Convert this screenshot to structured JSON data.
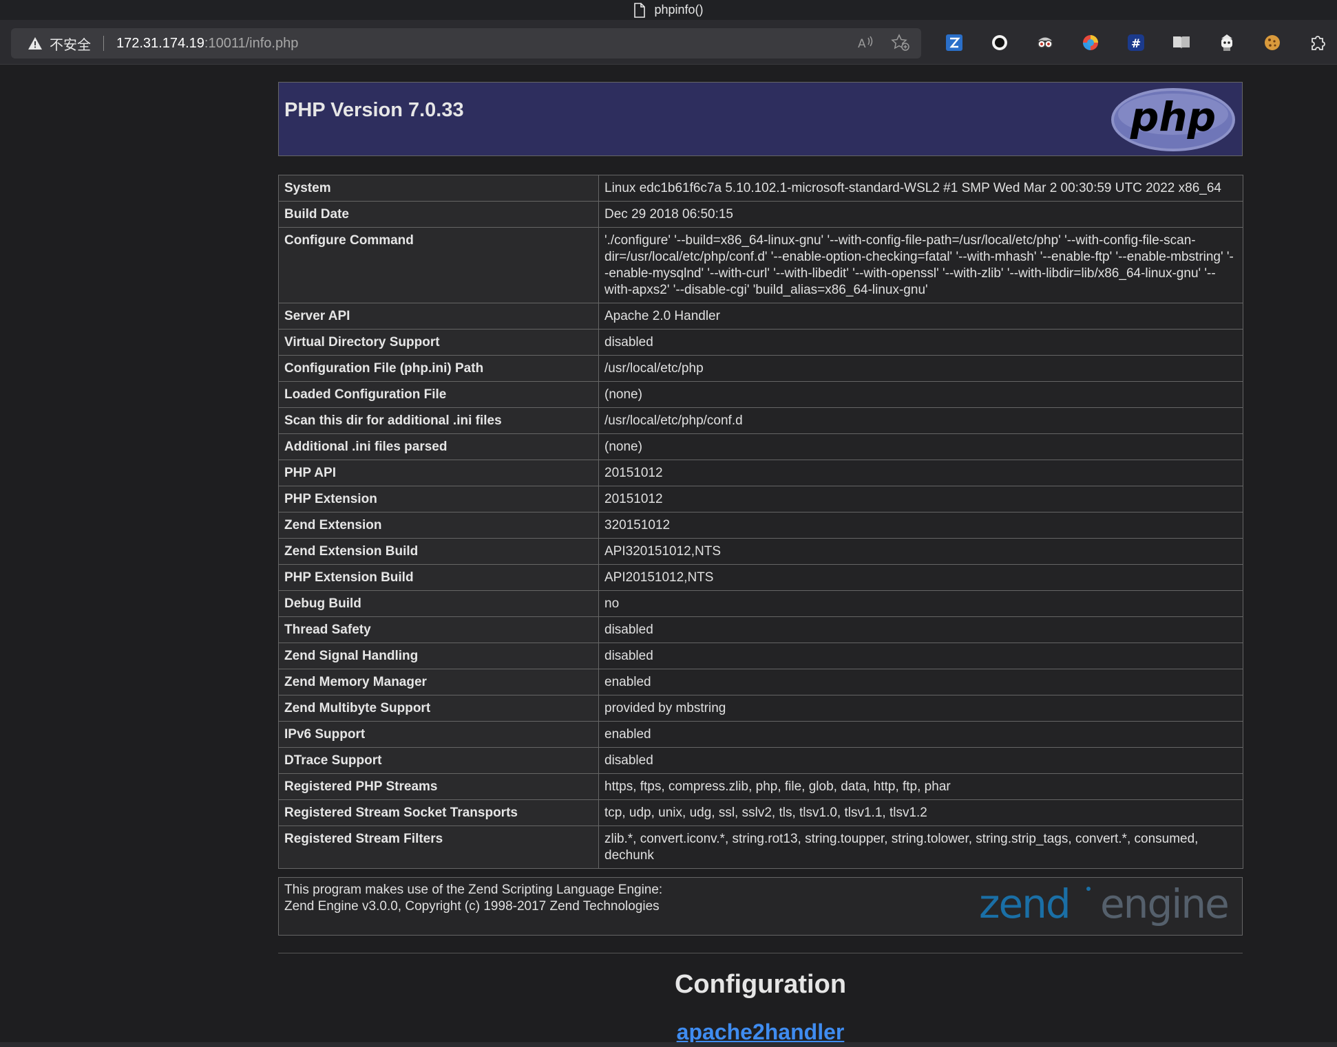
{
  "window": {
    "title": "phpinfo()"
  },
  "addressbar": {
    "security_label": "不安全",
    "url_host": "172.31.174.19",
    "url_rest": ":10011/info.php"
  },
  "extensions": [
    "zotero-icon",
    "circle-icon",
    "face-icon",
    "colorful-icon",
    "hash-icon",
    "reader-icon",
    "bot-icon",
    "cookie-icon",
    "puzzle-icon"
  ],
  "header": {
    "version_title": "PHP Version 7.0.33"
  },
  "info_rows": [
    {
      "key": "System",
      "value": "Linux edc1b61f6c7a 5.10.102.1-microsoft-standard-WSL2 #1 SMP Wed Mar 2 00:30:59 UTC 2022 x86_64"
    },
    {
      "key": "Build Date",
      "value": "Dec 29 2018 06:50:15"
    },
    {
      "key": "Configure Command",
      "value": "'./configure' '--build=x86_64-linux-gnu' '--with-config-file-path=/usr/local/etc/php' '--with-config-file-scan-dir=/usr/local/etc/php/conf.d' '--enable-option-checking=fatal' '--with-mhash' '--enable-ftp' '--enable-mbstring' '--enable-mysqlnd' '--with-curl' '--with-libedit' '--with-openssl' '--with-zlib' '--with-libdir=lib/x86_64-linux-gnu' '--with-apxs2' '--disable-cgi' 'build_alias=x86_64-linux-gnu'"
    },
    {
      "key": "Server API",
      "value": "Apache 2.0 Handler"
    },
    {
      "key": "Virtual Directory Support",
      "value": "disabled"
    },
    {
      "key": "Configuration File (php.ini) Path",
      "value": "/usr/local/etc/php"
    },
    {
      "key": "Loaded Configuration File",
      "value": "(none)"
    },
    {
      "key": "Scan this dir for additional .ini files",
      "value": "/usr/local/etc/php/conf.d"
    },
    {
      "key": "Additional .ini files parsed",
      "value": "(none)"
    },
    {
      "key": "PHP API",
      "value": "20151012"
    },
    {
      "key": "PHP Extension",
      "value": "20151012"
    },
    {
      "key": "Zend Extension",
      "value": "320151012"
    },
    {
      "key": "Zend Extension Build",
      "value": "API320151012,NTS"
    },
    {
      "key": "PHP Extension Build",
      "value": "API20151012,NTS"
    },
    {
      "key": "Debug Build",
      "value": "no"
    },
    {
      "key": "Thread Safety",
      "value": "disabled"
    },
    {
      "key": "Zend Signal Handling",
      "value": "disabled"
    },
    {
      "key": "Zend Memory Manager",
      "value": "enabled"
    },
    {
      "key": "Zend Multibyte Support",
      "value": "provided by mbstring"
    },
    {
      "key": "IPv6 Support",
      "value": "enabled"
    },
    {
      "key": "DTrace Support",
      "value": "disabled"
    },
    {
      "key": "Registered PHP Streams",
      "value": "https, ftps, compress.zlib, php, file, glob, data, http, ftp, phar"
    },
    {
      "key": "Registered Stream Socket Transports",
      "value": "tcp, udp, unix, udg, ssl, sslv2, tls, tlsv1.0, tlsv1.1, tlsv1.2"
    },
    {
      "key": "Registered Stream Filters",
      "value": "zlib.*, convert.iconv.*, string.rot13, string.toupper, string.tolower, string.strip_tags, convert.*, consumed, dechunk"
    }
  ],
  "zend": {
    "line1": "This program makes use of the Zend Scripting Language Engine:",
    "line2": "Zend Engine v3.0.0, Copyright (c) 1998-2017 Zend Technologies",
    "logo_word1": "zend",
    "logo_word2": "engine"
  },
  "config_title": "Configuration",
  "apache_link": "apache2handler",
  "logo_text": "php"
}
